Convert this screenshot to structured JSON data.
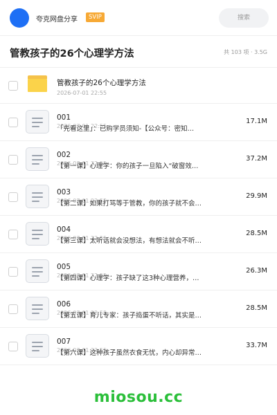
{
  "header": {
    "user_name": "夸克网盘分享",
    "badge": "SVIP",
    "search_placeholder": "搜索"
  },
  "title_bar": {
    "title": "管教孩子的26个心理学方法",
    "meta": "共 103 项 · 3.5G"
  },
  "folder": {
    "name": "管教孩子的26个心理学方法",
    "date": "2026-07-01 22:55"
  },
  "files": [
    {
      "num": "001",
      "date": "2026-07-01 22:55",
      "desc": "「先看这里」：已购学员须知-【公众号：密知…",
      "size": "17.1M"
    },
    {
      "num": "002",
      "date": "2026-07-01 22:55",
      "desc": "【第一课】心理学：你的孩子一旦陷入“破窗效…",
      "size": "37.2M"
    },
    {
      "num": "003",
      "date": "2026-07-01 22:55",
      "desc": "【第二课】如果打骂等于管教，你的孩子就不会…",
      "size": "29.9M"
    },
    {
      "num": "004",
      "date": "2026-07-01 22:55",
      "desc": "【第三课】太听话就会没想法，有想法就会不听…",
      "size": "28.5M"
    },
    {
      "num": "005",
      "date": "2026-07-01 22:55",
      "desc": "【第四课】心理学：孩子缺了这3种心理营养，…",
      "size": "26.3M"
    },
    {
      "num": "006",
      "date": "2026-07-01 22:55",
      "desc": "【第五课】育儿专家：孩子捣蛋不听话，其实是…",
      "size": "28.5M"
    },
    {
      "num": "007",
      "date": "2026-07-01 22:55",
      "desc": "【第六课】这种孩子虽然衣食无忧，内心却异常…",
      "size": "33.7M"
    }
  ],
  "watermark": "miosou.cc",
  "colors": {
    "avatar": "#1e6ff5",
    "svip_badge": "#f7a935",
    "folder": "#fbd34a",
    "watermark": "#2bbf3a"
  }
}
